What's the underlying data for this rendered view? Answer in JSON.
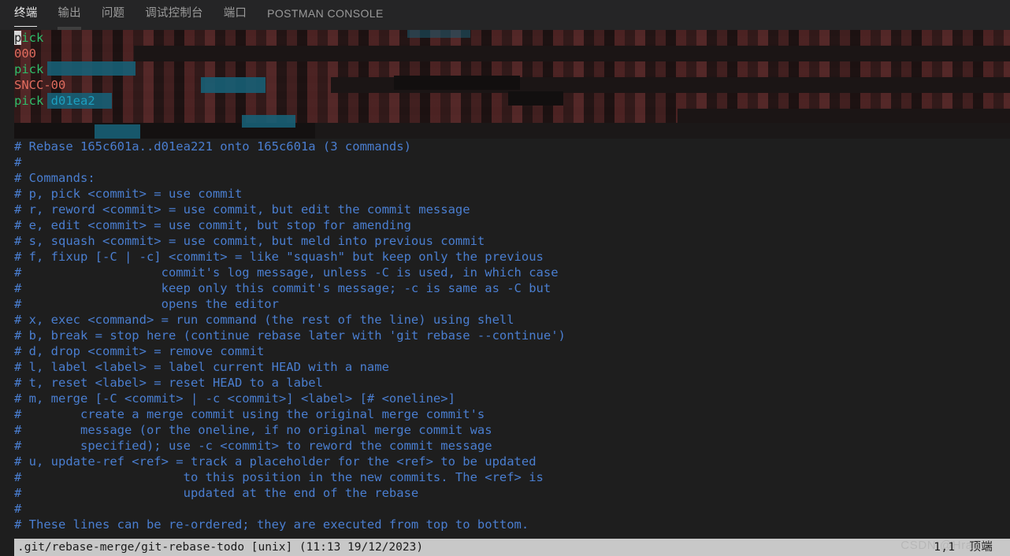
{
  "panel": {
    "tabs": [
      {
        "label": "终端",
        "active": true,
        "latin": false
      },
      {
        "label": "输出",
        "active": false,
        "latin": false
      },
      {
        "label": "问题",
        "active": false,
        "latin": false
      },
      {
        "label": "调试控制台",
        "active": false,
        "latin": false
      },
      {
        "label": "端口",
        "active": false,
        "latin": false
      },
      {
        "label": "POSTMAN CONSOLE",
        "active": false,
        "latin": true
      }
    ]
  },
  "editor": {
    "redacted_lines": [
      {
        "prefix_cursor": "p",
        "prefix": "ick",
        "prefix_class": "tok-green",
        "redacted": true
      },
      {
        "prefix_cursor": "",
        "prefix": "000",
        "prefix_class": "tok-red",
        "redacted": true
      },
      {
        "prefix_cursor": "",
        "prefix": "pick",
        "prefix_class": "tok-green",
        "redacted": true
      },
      {
        "prefix_cursor": "",
        "prefix": "SNCC-00",
        "prefix_class": "tok-red",
        "redacted": true
      },
      {
        "prefix_cursor": "",
        "prefix": "pick ",
        "prefix_class": "tok-green",
        "suffix": "d01ea2",
        "suffix_class": "tok-cyan",
        "redacted": true
      },
      {
        "prefix_cursor": "",
        "prefix": "",
        "prefix_class": "tok-red",
        "redacted": true
      }
    ],
    "comment_lines": [
      "# Rebase 165c601a..d01ea221 onto 165c601a (3 commands)",
      "#",
      "# Commands:",
      "# p, pick <commit> = use commit",
      "# r, reword <commit> = use commit, but edit the commit message",
      "# e, edit <commit> = use commit, but stop for amending",
      "# s, squash <commit> = use commit, but meld into previous commit",
      "# f, fixup [-C | -c] <commit> = like \"squash\" but keep only the previous",
      "#                   commit's log message, unless -C is used, in which case",
      "#                   keep only this commit's message; -c is same as -C but",
      "#                   opens the editor",
      "# x, exec <command> = run command (the rest of the line) using shell",
      "# b, break = stop here (continue rebase later with 'git rebase --continue')",
      "# d, drop <commit> = remove commit",
      "# l, label <label> = label current HEAD with a name",
      "# t, reset <label> = reset HEAD to a label",
      "# m, merge [-C <commit> | -c <commit>] <label> [# <oneline>]",
      "#        create a merge commit using the original merge commit's",
      "#        message (or the oneline, if no original merge commit was",
      "#        specified); use -c <commit> to reword the commit message",
      "# u, update-ref <ref> = track a placeholder for the <ref> to be updated",
      "#                      to this position in the new commits. The <ref> is",
      "#                      updated at the end of the rebase",
      "#",
      "# These lines can be re-ordered; they are executed from top to bottom."
    ]
  },
  "statusbar": {
    "file": ".git/rebase-merge/git-rebase-todo [unix] (11:13 19/12/2023)",
    "position": "1,1",
    "scroll": "顶端"
  },
  "watermark": {
    "text": "CSDN @Hrad..."
  },
  "colors": {
    "background": "#1e1e1e",
    "tabbar_background": "#252526",
    "comment_blue": "#4a7ed0",
    "hash_cyan": "#1c9fc0",
    "pick_green": "#2fbd6a",
    "subject_red": "#e06c5e",
    "statusbar_background": "#c8c8c8",
    "tab_active_text": "#e7e7e7",
    "tab_inactive_text": "#9a9a9a"
  }
}
